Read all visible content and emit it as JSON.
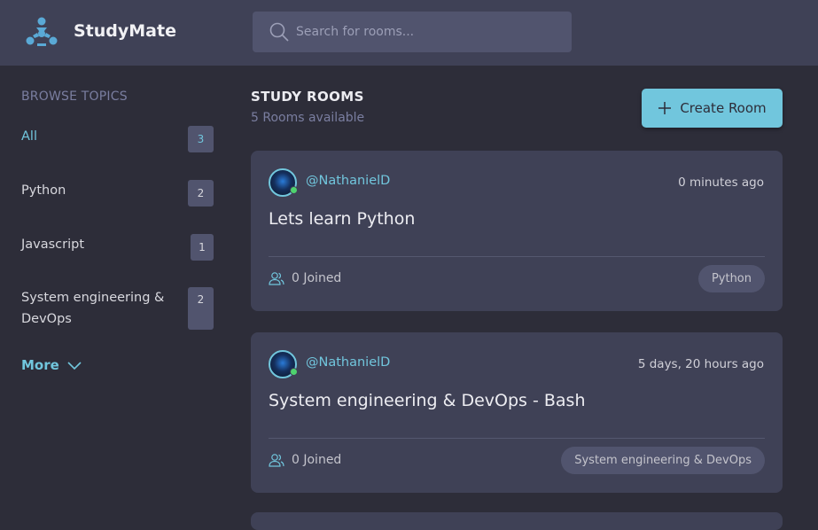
{
  "header": {
    "brand": "StudyMate",
    "search_placeholder": "Search for rooms..."
  },
  "sidebar": {
    "title": "BROWSE TOPICS",
    "topics": [
      {
        "label": "All",
        "count": "3",
        "active": true
      },
      {
        "label": "Python",
        "count": "2"
      },
      {
        "label": "Javascript",
        "count": "1"
      },
      {
        "label": "System engineering & DevOps",
        "count": "2"
      }
    ],
    "more_label": "More"
  },
  "main": {
    "title": "STUDY ROOMS",
    "subtitle": "5 Rooms available",
    "create_label": "Create Room",
    "rooms": [
      {
        "host": "@NathanielD",
        "time": "0 minutes ago",
        "name": "Lets learn Python",
        "joined": "0 Joined",
        "topic": "Python"
      },
      {
        "host": "@NathanielD",
        "time": "5 days, 20 hours ago",
        "name": "System engineering & DevOps - Bash",
        "joined": "0 Joined",
        "topic": "System engineering & DevOps"
      }
    ]
  },
  "colors": {
    "accent": "#71c6dd",
    "header_bg": "#3f4156",
    "page_bg": "#2d2d39",
    "card_bg": "#3f4156",
    "online": "#4ed36e"
  },
  "icons": [
    "studymate-logo-icon",
    "search-icon",
    "chevron-down-icon",
    "plus-icon",
    "users-icon"
  ]
}
